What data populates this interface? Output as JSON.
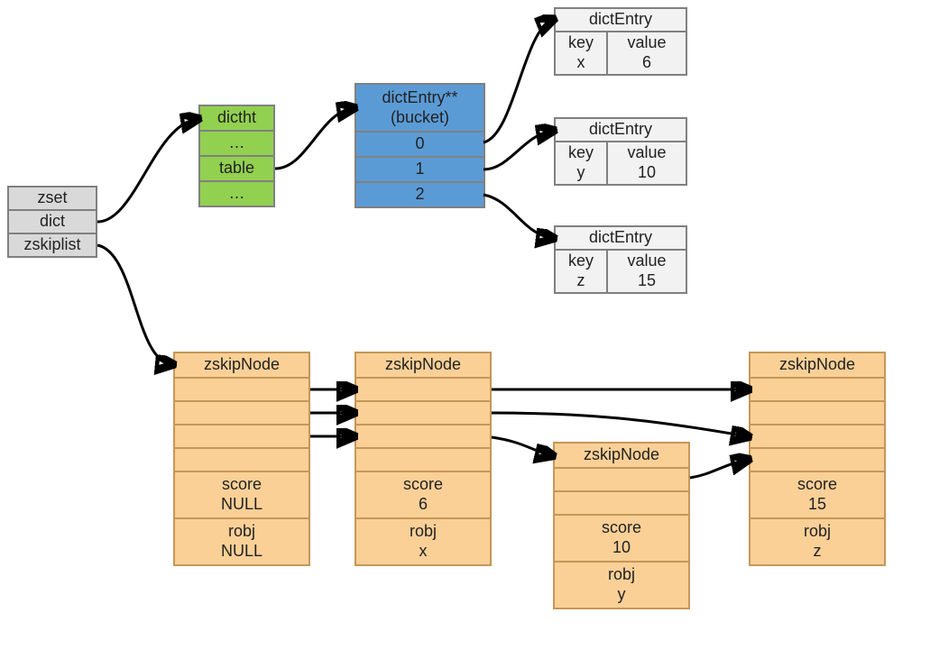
{
  "zset": {
    "title": "zset",
    "dict": "dict",
    "zskiplist": "zskiplist"
  },
  "dictht": {
    "title": "dictht",
    "dots1": "…",
    "table": "table",
    "dots2": "…"
  },
  "bucket": {
    "title": "dictEntry**\n(bucket)",
    "slots": [
      "0",
      "1",
      "2"
    ]
  },
  "entries": [
    {
      "title": "dictEntry",
      "keyLabel": "key",
      "keyVal": "x",
      "valLabel": "value",
      "valVal": "6"
    },
    {
      "title": "dictEntry",
      "keyLabel": "key",
      "keyVal": "y",
      "valLabel": "value",
      "valVal": "10"
    },
    {
      "title": "dictEntry",
      "keyLabel": "key",
      "keyVal": "z",
      "valLabel": "value",
      "valVal": "15"
    }
  ],
  "skip": {
    "nodeTitle": "zskipNode",
    "nodes": [
      {
        "score": "score\nNULL",
        "robj": "robj\nNULL"
      },
      {
        "score": "score\n6",
        "robj": "robj\nx"
      },
      {
        "score": "score\n10",
        "robj": "robj\ny"
      },
      {
        "score": "score\n15",
        "robj": "robj\nz"
      }
    ]
  }
}
